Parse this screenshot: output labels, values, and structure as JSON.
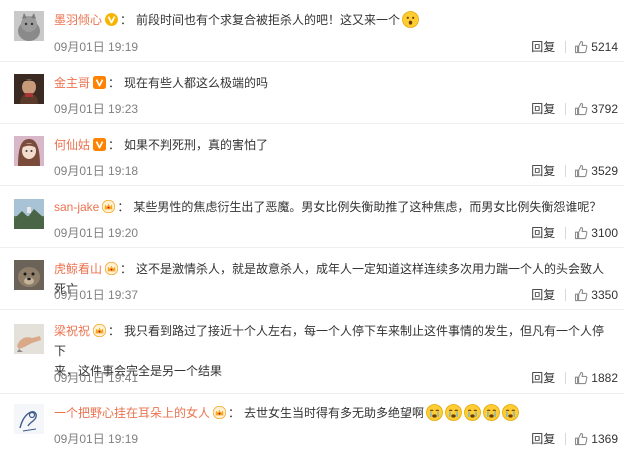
{
  "comments": [
    {
      "name": "墨羽倾心",
      "badge": "yellow-v",
      "text": "前段时间也有个求复合被拒杀人的吧！这又来一个",
      "emojis": [
        "surprised-emoji"
      ],
      "time": "09月01日 19:19",
      "reply": "回复",
      "likes": "5214"
    },
    {
      "name": "金主哥",
      "badge": "orange-v",
      "text": "现在有些人都这么极端的吗",
      "emojis": [],
      "time": "09月01日 19:23",
      "reply": "回复",
      "likes": "3792"
    },
    {
      "name": "何仙姑",
      "badge": "orange-v",
      "text": "如果不判死刑，真的害怕了",
      "emojis": [],
      "time": "09月01日 19:18",
      "reply": "回复",
      "likes": "3529"
    },
    {
      "name": "san-jake",
      "badge": "crown",
      "text": "某些男性的焦虑衍生出了恶魔。男女比例失衡助推了这种焦虑，而男女比例失衡怨谁呢？",
      "emojis": [],
      "time": "09月01日 19:20",
      "reply": "回复",
      "likes": "3100"
    },
    {
      "name": "虎鲸看山",
      "badge": "crown",
      "text": "这不是激情杀人，就是故意杀人，成年人一定知道这样连续多次用力踹一个人的头会致人死亡",
      "emojis": [],
      "time": "09月01日 19:37",
      "reply": "回复",
      "likes": "3350"
    },
    {
      "name": "梁祝祝",
      "badge": "crown",
      "text_line1": "我只看到路过了接近十个人左右，每一个人停下车来制止这件事情的发生，但凡有一个人停下",
      "text_line2": "来，这件事会完全是另一个结果",
      "emojis": [],
      "time": "09月01日 19:41",
      "reply": "回复",
      "likes": "1882"
    },
    {
      "name": "一个把野心挂在耳朵上的女人",
      "badge": "crown",
      "text": "去世女生当时得有多无助多绝望啊",
      "emojis": [
        "crying-emoji",
        "crying-emoji",
        "crying-emoji",
        "crying-emoji",
        "crying-emoji"
      ],
      "time": "09月01日 19:19",
      "reply": "回复",
      "likes": "1369"
    }
  ],
  "separator": "：",
  "colors": {
    "name": "#eb7350",
    "meta": "#808080",
    "badge_yellow": "#f7b500",
    "badge_orange": "#ff8200",
    "crown": "#f5a623"
  }
}
